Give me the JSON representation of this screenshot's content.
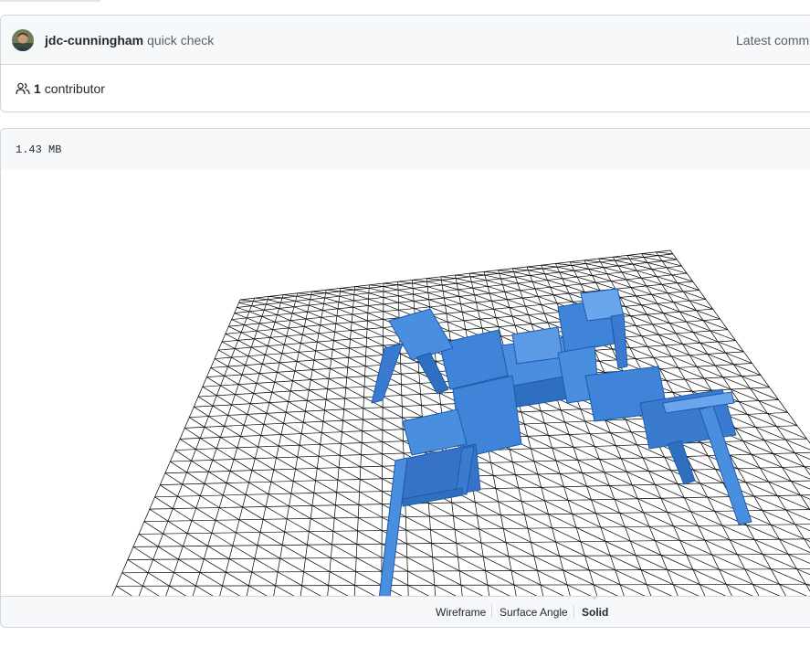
{
  "commit": {
    "author": "jdc-cunningham",
    "message": "quick check",
    "latest_label": "Latest commi"
  },
  "contributors": {
    "count": "1",
    "label": "contributor"
  },
  "file": {
    "size": "1.43 MB"
  },
  "viewer": {
    "model_color": "#3d7fd1",
    "grid_color": "#000000",
    "modes": [
      "Wireframe",
      "Surface Angle",
      "Solid"
    ],
    "active_mode": "Solid"
  },
  "icons": [
    "avatar",
    "people-icon"
  ]
}
